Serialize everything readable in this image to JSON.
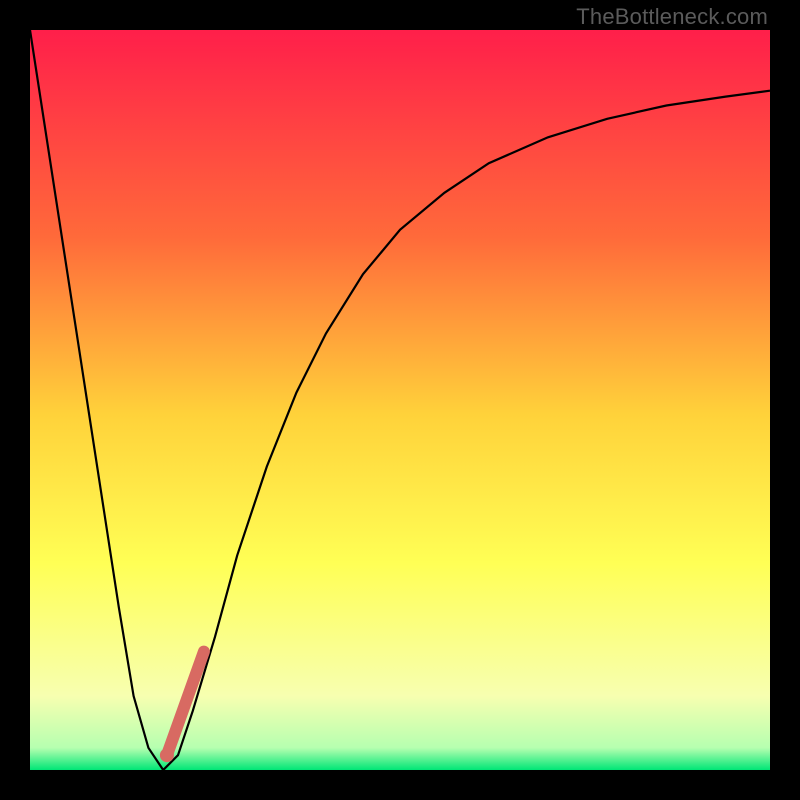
{
  "watermark": "TheBottleneck.com",
  "colors": {
    "frame": "#000000",
    "gradient_top": "#ff1f4a",
    "gradient_mid_upper": "#ff843a",
    "gradient_mid": "#ffd23a",
    "gradient_mid_lower": "#ffff55",
    "gradient_lower": "#f7ffb0",
    "gradient_bottom": "#00e676",
    "curve": "#000000",
    "marker": "#d86a62"
  },
  "chart_data": {
    "type": "line",
    "title": "",
    "xlabel": "",
    "ylabel": "",
    "xlim": [
      0,
      100
    ],
    "ylim": [
      0,
      100
    ],
    "grid": false,
    "series": [
      {
        "name": "bottleneck-curve",
        "x": [
          0,
          2,
          4,
          6,
          8,
          10,
          12,
          14,
          16,
          18,
          20,
          22,
          25,
          28,
          32,
          36,
          40,
          45,
          50,
          56,
          62,
          70,
          78,
          86,
          94,
          100
        ],
        "y": [
          100,
          87,
          74,
          61,
          48,
          35,
          22,
          10,
          3,
          0,
          2,
          8,
          18,
          29,
          41,
          51,
          59,
          67,
          73,
          78,
          82,
          85.5,
          88,
          89.8,
          91,
          91.8
        ]
      }
    ],
    "annotations": [
      {
        "name": "highlighted-segment",
        "type": "line-segment",
        "x": [
          18.5,
          23.5
        ],
        "y": [
          2,
          16
        ],
        "stroke_width_px": 12,
        "color": "#d86a62"
      }
    ],
    "minimum": {
      "x": 18,
      "y": 0
    }
  }
}
